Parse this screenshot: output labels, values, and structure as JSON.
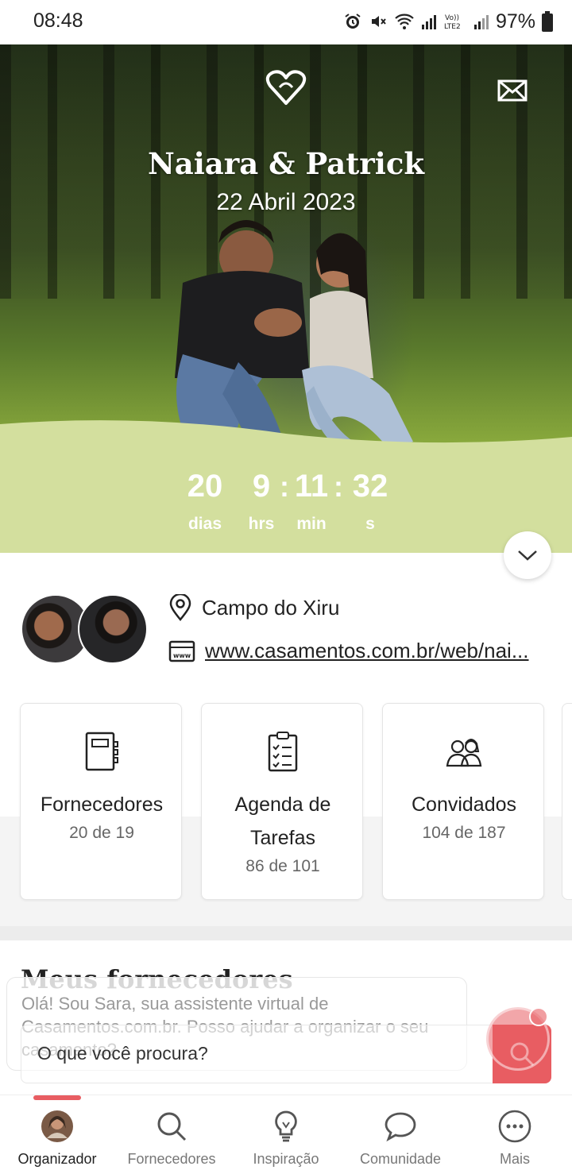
{
  "status_bar": {
    "time": "08:48",
    "battery": "97%"
  },
  "hero": {
    "couple_names": "Naiara & Patrick",
    "date": "22 Abril 2023",
    "countdown": [
      {
        "value": "20",
        "label": "dias"
      },
      {
        "value": "9",
        "label": "hrs"
      },
      {
        "value": "11",
        "label": "min"
      },
      {
        "value": "32",
        "label": "s"
      }
    ],
    "separator": ":"
  },
  "info": {
    "location": "Campo do Xiru",
    "website": "www.casamentos.com.br/web/nai..."
  },
  "cards": [
    {
      "title": "Fornecedores",
      "count": "20 de 19",
      "icon": "notebook-icon"
    },
    {
      "title": "Agenda de Tarefas",
      "count": "86 de 101",
      "icon": "checklist-icon"
    },
    {
      "title": "Convidados",
      "count": "104 de 187",
      "icon": "guests-icon"
    }
  ],
  "section_title": "Meus fornecedores",
  "assistant": {
    "message": "Olá! Sou Sara, sua assistente virtual de Casamentos.com.br. Posso ajudar a organizar o seu casamento?",
    "search_placeholder": "O que você procura?"
  },
  "bottom_nav": [
    {
      "label": "Organizador",
      "icon": "profile-photo",
      "active": true
    },
    {
      "label": "Fornecedores",
      "icon": "search-icon",
      "active": false
    },
    {
      "label": "Inspiração",
      "icon": "lightbulb-icon",
      "active": false
    },
    {
      "label": "Comunidade",
      "icon": "chat-bubble-icon",
      "active": false
    },
    {
      "label": "Mais",
      "icon": "more-icon",
      "active": false
    }
  ],
  "colors": {
    "accent": "#e85d62",
    "green_band": "#d3df9e"
  }
}
